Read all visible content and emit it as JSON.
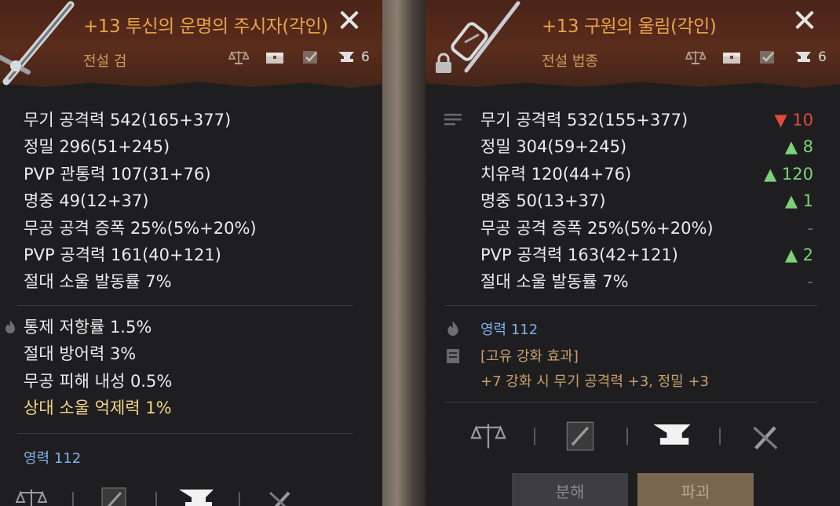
{
  "left_panel": {
    "title": "+13 투신의 운명의 주시자(각인)",
    "subtitle": "전설 검",
    "forge_count": "6",
    "stats": [
      "무기 공격력 542(165+377)",
      "정밀 296(51+245)",
      "PVP 관통력 107(31+76)",
      "명중 49(12+37)",
      "무공 공격 증폭 25%(5%+20%)",
      "PVP 공격력 161(40+121)",
      "절대 소울 발동률 7%"
    ],
    "extra_stats": [
      "통제 저항률 1.5%",
      "절대 방어력 3%",
      "무공 피해 내성 0.5%",
      "상대 소울 억제력 1%"
    ],
    "spirit": "영력 112"
  },
  "right_panel": {
    "title": "+13 구원의 울림(각인)",
    "subtitle": "전설 법종",
    "forge_count": "6",
    "stats": [
      "무기 공격력 532(155+377)",
      "정밀 304(59+245)",
      "치유력 120(44+76)",
      "명중 50(13+37)",
      "무공 공격 증폭 25%(5%+20%)",
      "PVP 공격력 163(42+121)",
      "절대 소울 발동률 7%"
    ],
    "diffs": [
      {
        "dir": "down",
        "text": "▼ 10"
      },
      {
        "dir": "up",
        "text": "▲ 8"
      },
      {
        "dir": "up",
        "text": "▲ 120"
      },
      {
        "dir": "up",
        "text": "▲ 1"
      },
      {
        "dir": "none",
        "text": "-"
      },
      {
        "dir": "up",
        "text": "▲ 2"
      },
      {
        "dir": "none",
        "text": "-"
      }
    ],
    "spirit": "영력 112",
    "enhance_header": "[고유 강화 효과]",
    "enhance_line": "+7 강화 시 무기 공격력 +3, 정밀 +3",
    "buttons": {
      "disassemble": "분해",
      "destroy": "파괴"
    }
  },
  "icons": {
    "close": "close-x-icon",
    "scale": "scale-icon",
    "chest": "chest-icon",
    "check": "check-box-icon",
    "anvil": "anvil-icon",
    "hammer": "hammer-icon",
    "sword_card": "sword-card-icon",
    "lock": "lock-icon",
    "fire": "fire-icon",
    "doc": "document-icon",
    "list": "list-icon"
  },
  "colors": {
    "title": "#e8a24a",
    "subtitle": "#d39a5c",
    "up": "#7cd17a",
    "down": "#e24a3c",
    "spirit": "#7fb0e8",
    "gold_text": "#f2d48a"
  }
}
